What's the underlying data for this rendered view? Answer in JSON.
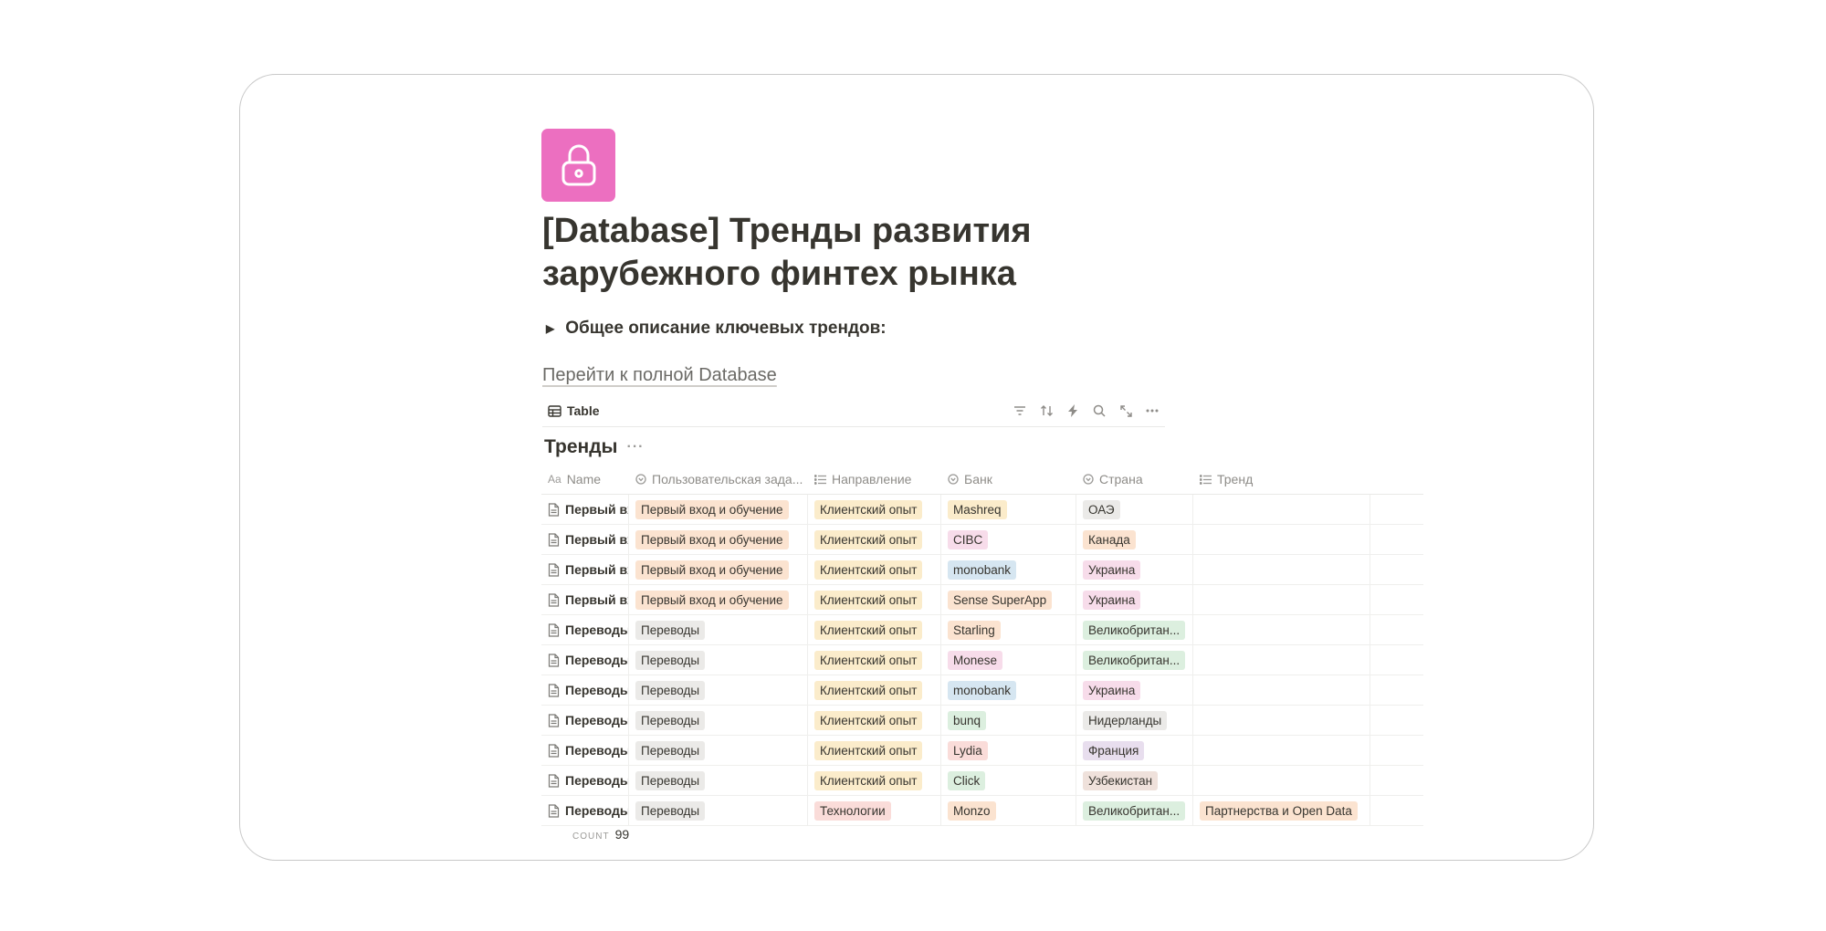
{
  "page": {
    "icon": "lock-icon",
    "title": "[Database] Тренды развития зарубежного финтех рынка",
    "toggle_label": "Общее описание ключевых трендов:",
    "db_link": "Перейти к полной Database"
  },
  "view": {
    "tab_label": "Table",
    "tools": [
      "filter-icon",
      "sort-icon",
      "automation-icon",
      "search-icon",
      "expand-icon",
      "more-icon"
    ]
  },
  "database": {
    "title": "Тренды",
    "columns": [
      {
        "label": "Name",
        "icon": "Aa"
      },
      {
        "label": "Пользовательская зада...",
        "icon": "select-icon"
      },
      {
        "label": "Направление",
        "icon": "multiselect-icon"
      },
      {
        "label": "Банк",
        "icon": "select-icon"
      },
      {
        "label": "Страна",
        "icon": "select-icon"
      },
      {
        "label": "Тренд",
        "icon": "multiselect-icon"
      }
    ],
    "rows": [
      {
        "name": "Первый вх",
        "task": "Первый вход и обучение",
        "task_color": "orange",
        "dir": "Клиентский опыт",
        "dir_color": "yellow",
        "bank": "Mashreq",
        "bank_color": "yellow",
        "country": "ОАЭ",
        "country_color": "gray",
        "trend": "",
        "trend_color": ""
      },
      {
        "name": "Первый вх",
        "task": "Первый вход и обучение",
        "task_color": "orange",
        "dir": "Клиентский опыт",
        "dir_color": "yellow",
        "bank": "CIBC",
        "bank_color": "pink",
        "country": "Канада",
        "country_color": "orange",
        "trend": "",
        "trend_color": ""
      },
      {
        "name": "Первый вх",
        "task": "Первый вход и обучение",
        "task_color": "orange",
        "dir": "Клиентский опыт",
        "dir_color": "yellow",
        "bank": "monobank",
        "bank_color": "blue",
        "country": "Украина",
        "country_color": "pink",
        "trend": "",
        "trend_color": ""
      },
      {
        "name": "Первый вх",
        "task": "Первый вход и обучение",
        "task_color": "orange",
        "dir": "Клиентский опыт",
        "dir_color": "yellow",
        "bank": "Sense SuperApp",
        "bank_color": "orange",
        "country": "Украина",
        "country_color": "pink",
        "trend": "",
        "trend_color": ""
      },
      {
        "name": "Переводы",
        "task": "Переводы",
        "task_color": "gray",
        "dir": "Клиентский опыт",
        "dir_color": "yellow",
        "bank": "Starling",
        "bank_color": "orange",
        "country": "Великобритан...",
        "country_color": "green",
        "trend": "",
        "trend_color": ""
      },
      {
        "name": "Переводы",
        "task": "Переводы",
        "task_color": "gray",
        "dir": "Клиентский опыт",
        "dir_color": "yellow",
        "bank": "Monese",
        "bank_color": "pink",
        "country": "Великобритан...",
        "country_color": "green",
        "trend": "",
        "trend_color": ""
      },
      {
        "name": "Переводы",
        "task": "Переводы",
        "task_color": "gray",
        "dir": "Клиентский опыт",
        "dir_color": "yellow",
        "bank": "monobank",
        "bank_color": "blue",
        "country": "Украина",
        "country_color": "pink",
        "trend": "",
        "trend_color": ""
      },
      {
        "name": "Переводы",
        "task": "Переводы",
        "task_color": "gray",
        "dir": "Клиентский опыт",
        "dir_color": "yellow",
        "bank": "bunq",
        "bank_color": "green",
        "country": "Нидерланды",
        "country_color": "gray",
        "trend": "",
        "trend_color": ""
      },
      {
        "name": "Переводы",
        "task": "Переводы",
        "task_color": "gray",
        "dir": "Клиентский опыт",
        "dir_color": "yellow",
        "bank": "Lydia",
        "bank_color": "red",
        "country": "Франция",
        "country_color": "purple",
        "trend": "",
        "trend_color": ""
      },
      {
        "name": "Переводы",
        "task": "Переводы",
        "task_color": "gray",
        "dir": "Клиентский опыт",
        "dir_color": "yellow",
        "bank": "Click",
        "bank_color": "green",
        "country": "Узбекистан",
        "country_color": "brown",
        "trend": "",
        "trend_color": ""
      },
      {
        "name": "Переводы",
        "task": "Переводы",
        "task_color": "gray",
        "dir": "Технологии",
        "dir_color": "red",
        "bank": "Monzo",
        "bank_color": "orange",
        "country": "Великобритан...",
        "country_color": "green",
        "trend": "Партнерства и Open Data",
        "trend_color": "orange"
      }
    ],
    "count_label": "COUNT",
    "count_value": "99"
  }
}
